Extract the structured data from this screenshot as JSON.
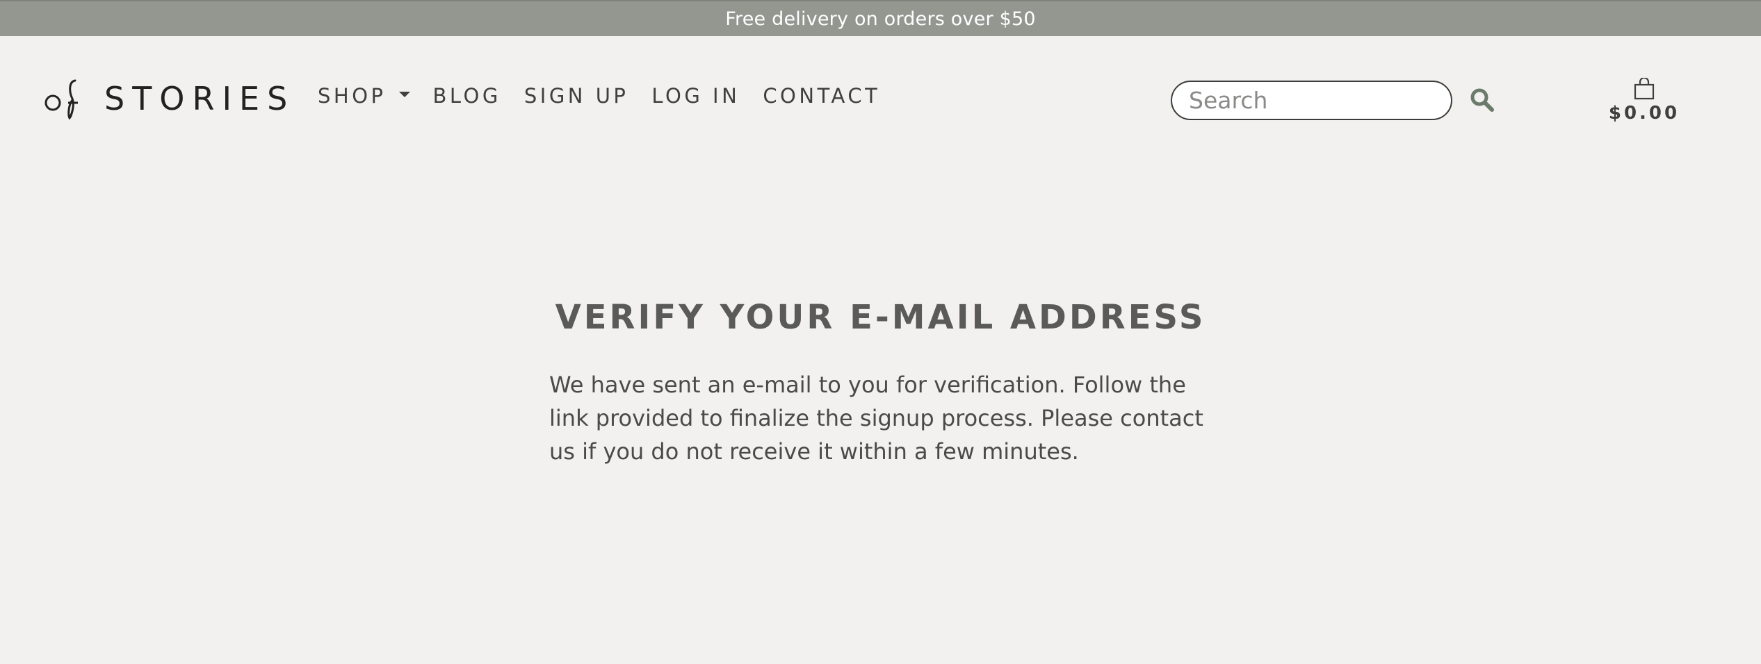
{
  "promo": {
    "text": "Free delivery on orders over $50"
  },
  "brand": {
    "name": "STORIES",
    "mark_icon": "of-monogram-icon"
  },
  "nav": {
    "items": [
      {
        "label": "SHOP",
        "has_dropdown": true
      },
      {
        "label": "BLOG"
      },
      {
        "label": "SIGN UP"
      },
      {
        "label": "LOG IN"
      },
      {
        "label": "CONTACT"
      }
    ]
  },
  "search": {
    "placeholder": "Search",
    "value": "",
    "icon": "search-icon"
  },
  "cart": {
    "icon": "shopping-bag-icon",
    "total": "$0.00"
  },
  "content": {
    "title": "VERIFY YOUR E-MAIL ADDRESS",
    "message": "We have sent an e-mail to you for verification. Follow the link provided to finalize the signup process. Please contact us if you do not receive it within a few minutes."
  },
  "colors": {
    "promo_bg": "#939790",
    "page_bg": "#f2f1ef",
    "text": "#4a4a48",
    "search_icon": "#6b7a6b"
  }
}
